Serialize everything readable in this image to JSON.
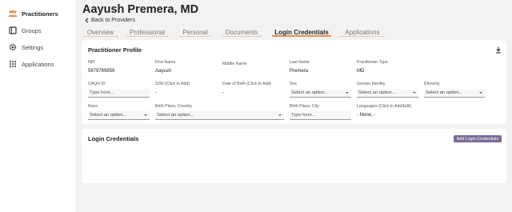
{
  "sidebar": {
    "items": [
      {
        "label": "Practitioners",
        "icon": "people-icon"
      },
      {
        "label": "Groups",
        "icon": "book-icon"
      },
      {
        "label": "Settings",
        "icon": "gear-icon"
      },
      {
        "label": "Applications",
        "icon": "grid-icon"
      }
    ]
  },
  "header": {
    "title": "Aayush Premera, MD",
    "back_label": "Back to Providers"
  },
  "tabs": [
    {
      "label": "Overview"
    },
    {
      "label": "Professional"
    },
    {
      "label": "Personal"
    },
    {
      "label": "Documents"
    },
    {
      "label": "Login Credentials"
    },
    {
      "label": "Applications"
    }
  ],
  "profile": {
    "title": "Practitioner Profile",
    "npi": {
      "label": "NPI",
      "value": "5679769856"
    },
    "first_name": {
      "label": "First Name",
      "value": "Aayush"
    },
    "middle_name": {
      "label": "Middle Name",
      "value": ""
    },
    "last_name": {
      "label": "Last Name",
      "value": "Premera"
    },
    "practitioner_type": {
      "label": "Practitioner Type",
      "value": "MD"
    },
    "caqh_id": {
      "label": "CAQH ID",
      "placeholder": "Type here..."
    },
    "ssn": {
      "label": "SSN (Click to Add)",
      "value": "-"
    },
    "dob": {
      "label": "Date of Birth (Click to Add)",
      "value": "-"
    },
    "sex": {
      "label": "Sex",
      "value": "Select an option..."
    },
    "gender_identity": {
      "label": "Gender Identity",
      "value": "Select an option..."
    },
    "ethnicity": {
      "label": "Ethnicity",
      "value": "Select an option..."
    },
    "race": {
      "label": "Race",
      "value": "Select an option..."
    },
    "birth_place_country": {
      "label": "Birth Place, Country",
      "value": "Select an option..."
    },
    "birth_place_city": {
      "label": "Birth Place, City",
      "placeholder": "Type here..."
    },
    "languages": {
      "label": "Languages (Click to Add/Edit)",
      "value": "- None, -"
    }
  },
  "login": {
    "title": "Login Credentials",
    "add_button": "Add Login Credentials"
  },
  "colors": {
    "accent_tab": "#e4934f",
    "sidebar_active_icon": "#e4934f",
    "add_button_bg": "#7a6a94"
  }
}
